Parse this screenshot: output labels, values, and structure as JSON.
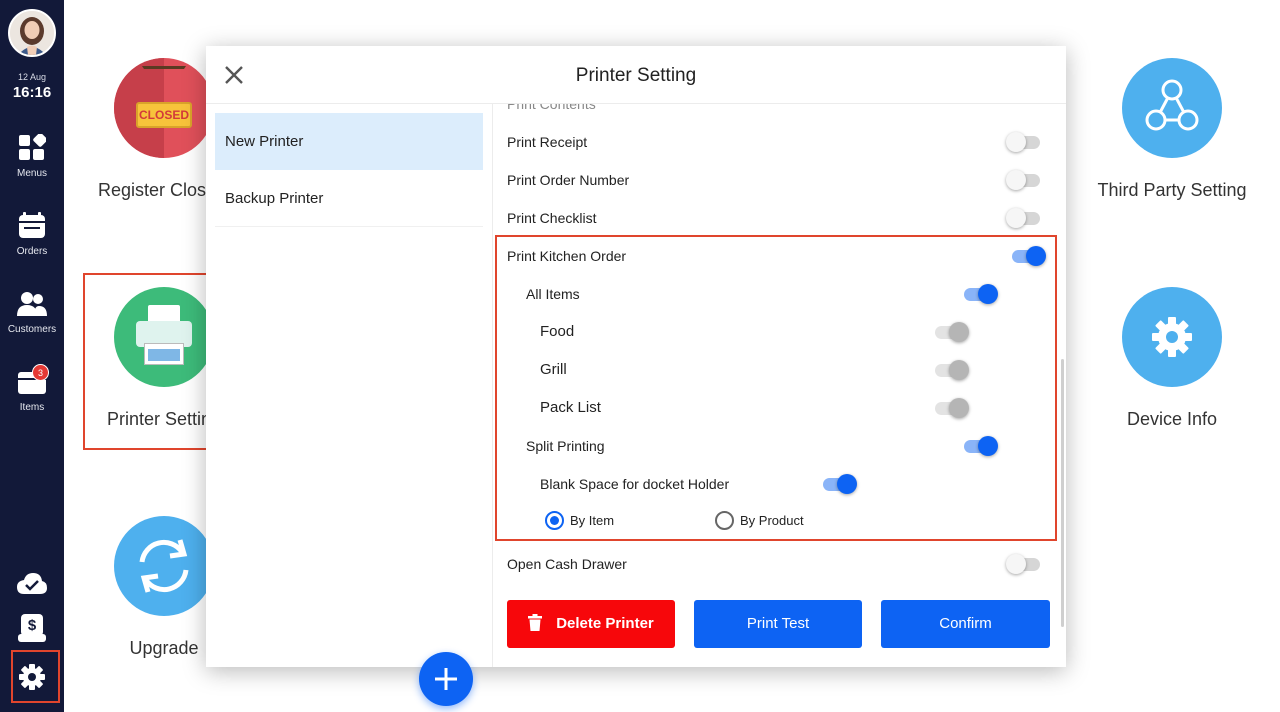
{
  "sidebar": {
    "date": "12 Aug",
    "time": "16:16",
    "items": [
      {
        "label": "Menus",
        "icon": "menus-icon"
      },
      {
        "label": "Orders",
        "icon": "orders-icon"
      },
      {
        "label": "Customers",
        "icon": "customers-icon"
      },
      {
        "label": "Items",
        "icon": "items-icon",
        "badge": "3"
      }
    ],
    "bottom_icons": [
      "cloud-check-icon",
      "cash-drawer-icon",
      "settings-gear-icon"
    ]
  },
  "tiles": {
    "register_closing": {
      "label": "Register Closing",
      "sign_text": "CLOSED"
    },
    "printer_setting": {
      "label": "Printer Setting"
    },
    "upgrade": {
      "label": "Upgrade"
    },
    "third_party": {
      "label": "Third Party Setting"
    },
    "device_info": {
      "label": "Device Info"
    }
  },
  "modal": {
    "title": "Printer Setting",
    "printers": [
      {
        "name": "New Printer",
        "selected": true
      },
      {
        "name": "Backup Printer",
        "selected": false
      }
    ],
    "section_title": "Print Contents",
    "settings": {
      "print_receipt": {
        "label": "Print Receipt",
        "state": "off"
      },
      "print_order_number": {
        "label": "Print Order Number",
        "state": "off"
      },
      "print_checklist": {
        "label": "Print Checklist",
        "state": "off"
      },
      "print_kitchen_order": {
        "label": "Print Kitchen Order",
        "state": "on"
      },
      "all_items": {
        "label": "All Items",
        "state": "on"
      },
      "food": {
        "label": "Food",
        "state": "disabled"
      },
      "grill": {
        "label": "Grill",
        "state": "disabled"
      },
      "pack_list": {
        "label": "Pack List",
        "state": "disabled"
      },
      "split_printing": {
        "label": "Split Printing",
        "state": "on"
      },
      "blank_space": {
        "label": "Blank Space for docket Holder",
        "state": "on"
      },
      "open_cash_drawer": {
        "label": "Open Cash Drawer",
        "state": "off"
      }
    },
    "split_mode": {
      "options": [
        "By Item",
        "By Product"
      ],
      "selected": "By Item"
    },
    "buttons": {
      "delete": "Delete Printer",
      "test": "Print Test",
      "confirm": "Confirm"
    }
  },
  "colors": {
    "sidebar_bg": "#121939",
    "accent_blue": "#0d63f3",
    "danger_red": "#f7070b",
    "highlight_border": "#e0452d",
    "selected_row": "#dcedfc"
  }
}
